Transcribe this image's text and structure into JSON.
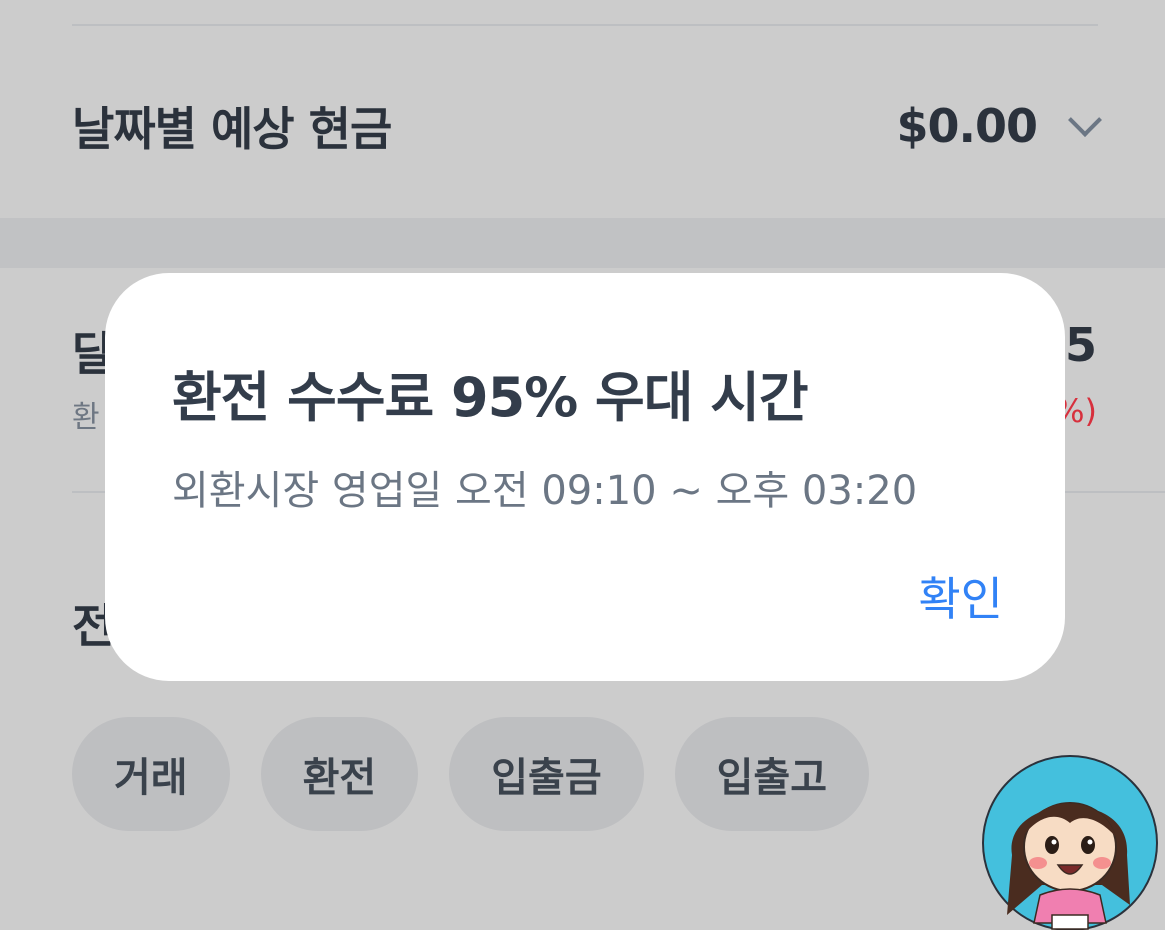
{
  "forecast": {
    "label": "날짜별 예상 현금",
    "value": "$0.00",
    "expand_icon": "chevron-down-icon"
  },
  "rate_section": {
    "title_visible": "달",
    "subtitle_visible": "환",
    "value_visible": "5",
    "change_visible": "%)"
  },
  "history": {
    "title_visible": "전"
  },
  "filters": {
    "chips": [
      "거래",
      "환전",
      "입출금",
      "입출고"
    ]
  },
  "dialog": {
    "title": "환전 수수료 95% 우대 시간",
    "message": "외환시장 영업일 오전 09:10 ~ 오후 03:20",
    "confirm_label": "확인"
  },
  "colors": {
    "accent": "#3182f6",
    "negative": "#d7303d",
    "overlay_bg": "#cccccc",
    "dialog_bg": "#ffffff"
  },
  "icons": {
    "avatar": "cartoon-girl-avatar-icon"
  }
}
